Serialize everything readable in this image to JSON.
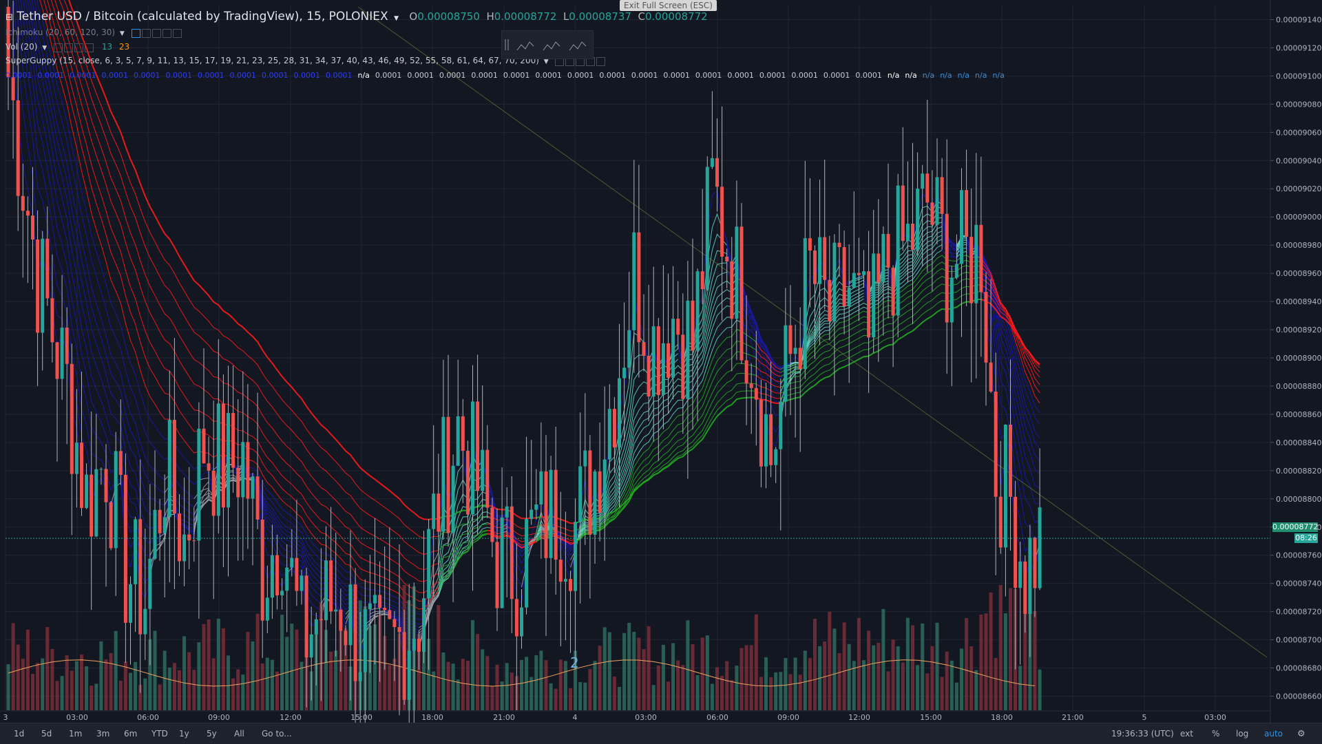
{
  "header": {
    "title": "Tether USD / Bitcoin (calculated by TradingView), 15, POLONIEX",
    "o_label": "O",
    "o_value": "0.00008750",
    "h_label": "H",
    "h_value": "0.00008772",
    "l_label": "L",
    "l_value": "0.00008737",
    "c_label": "C",
    "c_value": "0.00008772"
  },
  "fullscreen_tip": "Exit Full Screen (ESC)",
  "indicators": {
    "ichimoku": "Ichimoku (20, 60, 120, 30)",
    "vol": "Vol (20)",
    "vol_up": "13",
    "vol_down": "23",
    "superguppy": "SuperGuppy (15, close, 6, 3, 5, 7, 9, 11, 13, 15, 17, 19, 21, 23, 25, 28, 31, 34, 37, 40, 43, 46, 49, 52, 55, 58, 61, 64, 67, 70, 200)"
  },
  "guppy_values": [
    "0.0001",
    "0.0001",
    "0.0001",
    "0.0001",
    "0.0001",
    "0.0001",
    "0.0001",
    "0.0001",
    "0.0001",
    "0.0001",
    "0.0001",
    "n/a",
    "0.0001",
    "0.0001",
    "0.0001",
    "0.0001",
    "0.0001",
    "0.0001",
    "0.0001",
    "0.0001",
    "0.0001",
    "0.0001",
    "0.0001",
    "0.0001",
    "0.0001",
    "0.0001",
    "0.0001",
    "0.0001",
    "n/a",
    "n/a",
    "n/a",
    "n/a",
    "n/a",
    "n/a",
    "n/a"
  ],
  "wave_label": "2",
  "price_tag": {
    "value": "0.00008772",
    "countdown": "08:26"
  },
  "bottom_bar": {
    "timeframes": [
      "1d",
      "5d",
      "1m",
      "3m",
      "6m",
      "YTD",
      "1y",
      "5y",
      "All",
      "Go to..."
    ],
    "clock": "19:36:33 (UTC)",
    "ext": "ext",
    "percent": "%",
    "log": "log",
    "auto": "auto"
  },
  "colors": {
    "background": "#131722",
    "up": "#26a69a",
    "down": "#ef5350",
    "guppy_red": "#ff1a1a",
    "guppy_blue": "#1a1aa8",
    "guppy_green": "#22aa22",
    "guppy_gray": "#9aa0a6"
  },
  "chart_data": {
    "type": "candlestick",
    "symbol": "USDTBTC",
    "x_ticks": [
      "3",
      "03:00",
      "06:00",
      "09:00",
      "12:00",
      "15:00",
      "18:00",
      "21:00",
      "4",
      "03:00",
      "06:00",
      "09:00",
      "12:00",
      "15:00",
      "18:00",
      "21:00",
      "5",
      "03:00"
    ],
    "y_ticks": [
      "0.00009140",
      "0.00009120",
      "0.00009100",
      "0.00009080",
      "0.00009060",
      "0.00009040",
      "0.00009020",
      "0.00009000",
      "0.00008980",
      "0.00008960",
      "0.00008940",
      "0.00008920",
      "0.00008900",
      "0.00008880",
      "0.00008860",
      "0.00008840",
      "0.00008820",
      "0.00008800",
      "0.00008780",
      "0.00008760",
      "0.00008740",
      "0.00008720",
      "0.00008700",
      "0.00008680",
      "0.00008660"
    ],
    "ylim": [
      8.65e-05,
      9.15e-05
    ],
    "last_price": 8.772e-05,
    "price_keyframes": [
      [
        0,
        9.1e-05
      ],
      [
        3,
        9.03e-05
      ],
      [
        6,
        8.96e-05
      ],
      [
        9,
        8.92e-05
      ],
      [
        12,
        8.88e-05
      ],
      [
        16,
        8.8e-05
      ],
      [
        20,
        8.83e-05
      ],
      [
        24,
        8.75e-05
      ],
      [
        28,
        8.73e-05
      ],
      [
        32,
        8.82e-05
      ],
      [
        36,
        8.77e-05
      ],
      [
        40,
        8.84e-05
      ],
      [
        44,
        8.82e-05
      ],
      [
        48,
        8.83e-05
      ],
      [
        52,
        8.75e-05
      ],
      [
        56,
        8.78e-05
      ],
      [
        60,
        8.7e-05
      ],
      [
        64,
        8.72e-05
      ],
      [
        68,
        8.73e-05
      ],
      [
        72,
        8.7e-05
      ],
      [
        76,
        8.68e-05
      ],
      [
        80,
        8.7e-05
      ],
      [
        84,
        8.72e-05
      ],
      [
        88,
        8.8e-05
      ],
      [
        92,
        8.85e-05
      ],
      [
        96,
        8.81e-05
      ],
      [
        100,
        8.76e-05
      ],
      [
        104,
        8.75e-05
      ],
      [
        108,
        8.78e-05
      ],
      [
        112,
        8.79e-05
      ],
      [
        116,
        8.78e-05
      ],
      [
        120,
        8.82e-05
      ],
      [
        124,
        8.88e-05
      ],
      [
        128,
        8.96e-05
      ],
      [
        132,
        8.91e-05
      ],
      [
        136,
        8.93e-05
      ],
      [
        140,
        8.91e-05
      ],
      [
        144,
        9.02e-05
      ],
      [
        148,
        8.97e-05
      ],
      [
        152,
        8.91e-05
      ],
      [
        156,
        8.83e-05
      ],
      [
        160,
        8.9e-05
      ],
      [
        164,
        8.96e-05
      ],
      [
        168,
        8.93e-05
      ],
      [
        172,
        8.95e-05
      ],
      [
        176,
        8.91e-05
      ],
      [
        180,
        8.97e-05
      ],
      [
        184,
        8.98e-05
      ],
      [
        188,
        9.01e-05
      ],
      [
        192,
        8.97e-05
      ],
      [
        196,
        8.97e-05
      ],
      [
        199,
        8.98e-05
      ],
      [
        202,
        8.82e-05
      ],
      [
        205,
        8.8e-05
      ],
      [
        208,
        8.75e-05
      ],
      [
        211,
        8.77e-05
      ]
    ],
    "candle_count": 212,
    "volume_keyframes": [
      [
        0,
        0.5
      ],
      [
        20,
        0.45
      ],
      [
        40,
        0.5
      ],
      [
        60,
        0.55
      ],
      [
        80,
        0.75
      ],
      [
        100,
        0.4
      ],
      [
        120,
        0.45
      ],
      [
        140,
        0.5
      ],
      [
        160,
        0.55
      ],
      [
        180,
        0.6
      ],
      [
        195,
        0.55
      ],
      [
        202,
        1.0
      ],
      [
        211,
        0.5
      ]
    ],
    "vol_ma_approx": 0.35,
    "guppy_lines": 30
  }
}
